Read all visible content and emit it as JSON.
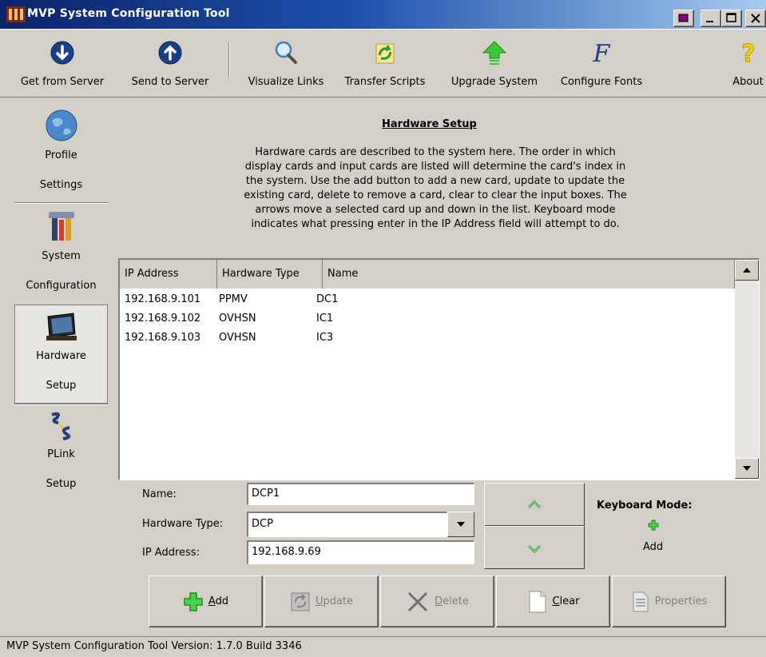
{
  "window": {
    "title": "MVP System Configuration Tool"
  },
  "toolbar": {
    "items": [
      {
        "label": "Get from Server",
        "icon": "download-circle-icon"
      },
      {
        "label": "Send to Server",
        "icon": "upload-circle-icon"
      },
      {
        "label": "Visualize Links",
        "icon": "magnifier-icon"
      },
      {
        "label": "Transfer Scripts",
        "icon": "transfer-scripts-icon"
      },
      {
        "label": "Upgrade System",
        "icon": "green-up-arrow-icon"
      },
      {
        "label": "Configure Fonts",
        "icon": "font-f-icon"
      },
      {
        "label": "About",
        "icon": "question-mark-icon"
      }
    ]
  },
  "nav": {
    "items": [
      {
        "line1": "Profile",
        "line2": "Settings",
        "icon": "globe-icon",
        "selected": false
      },
      {
        "line1": "System",
        "line2": "Configuration",
        "icon": "tools-icon",
        "selected": false
      },
      {
        "line1": "Hardware",
        "line2": "Setup",
        "icon": "monitor-icon",
        "selected": true
      },
      {
        "line1": "PLink",
        "line2": "Setup",
        "icon": "link-icon",
        "selected": false
      }
    ]
  },
  "main": {
    "heading": "Hardware Setup",
    "description": "Hardware cards are described to the system here. The order in which display cards and input cards are listed will determine the card's index in the system. Use the add button to add a new card, update to update the existing card, delete to remove a card, clear to clear the input boxes. The arrows move a selected card up and down in the list. Keyboard mode indicates what pressing enter in the IP Address field will attempt to do."
  },
  "table": {
    "columns": [
      "IP Address",
      "Hardware Type",
      "Name"
    ],
    "rows": [
      [
        "192.168.9.101",
        "PPMV",
        "DC1"
      ],
      [
        "192.168.9.102",
        "OVHSN",
        "IC1"
      ],
      [
        "192.168.9.103",
        "OVHSN",
        "IC3"
      ]
    ]
  },
  "form": {
    "name_label": "Name:",
    "name_value": "DCP1",
    "hardware_type_label": "Hardware Type:",
    "hardware_type_value": "DCP",
    "ip_label": "IP Address:",
    "ip_value": "192.168.9.69"
  },
  "keyboard_mode": {
    "title": "Keyboard Mode:",
    "value": "Add"
  },
  "actions": {
    "add": "Add",
    "update": "Update",
    "delete": "Delete",
    "clear": "Clear",
    "properties": "Properties"
  },
  "status": {
    "text": "MVP System Configuration Tool Version: 1.7.0 Build 3346"
  }
}
